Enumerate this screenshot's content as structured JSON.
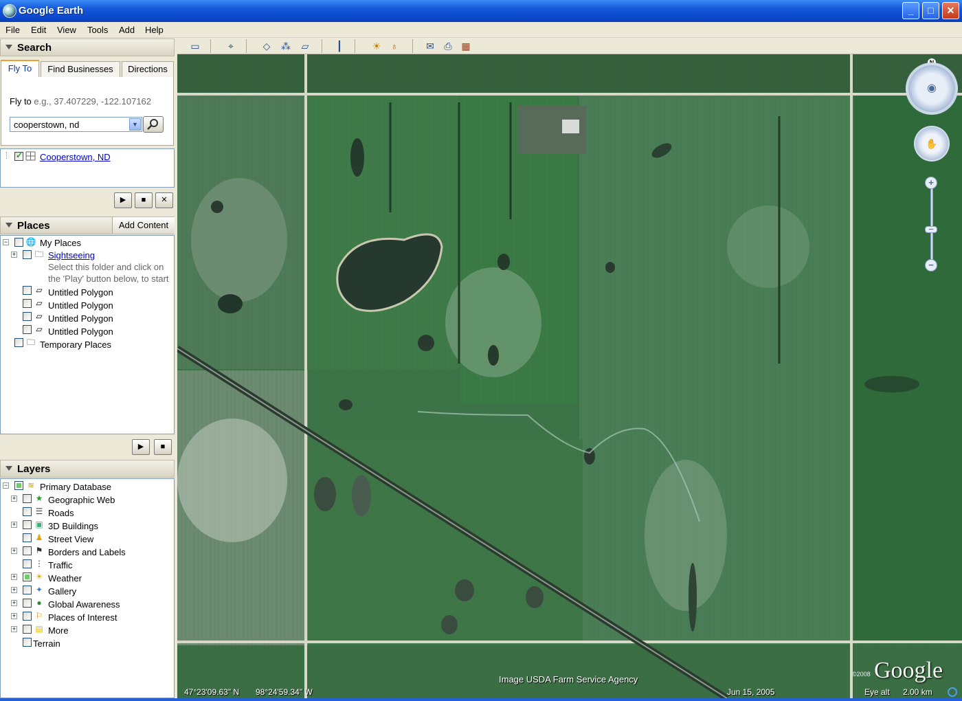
{
  "window": {
    "title": "Google Earth",
    "minimize": "_",
    "maximize": "□",
    "close": "✕"
  },
  "menu": [
    "File",
    "Edit",
    "View",
    "Tools",
    "Add",
    "Help"
  ],
  "search": {
    "header": "Search",
    "tabs": [
      "Fly To",
      "Find Businesses",
      "Directions"
    ],
    "fly_to_label": "Fly to",
    "fly_to_hint": "e.g., 37.407229, -122.107162",
    "input_value": "cooperstown, nd",
    "result": "Cooperstown, ND"
  },
  "places": {
    "header": "Places",
    "add_content": "Add Content",
    "my_places": "My Places",
    "sightseeing": "Sightseeing",
    "sightseeing_desc_1": "Select this folder and click on",
    "sightseeing_desc_2": "the 'Play' button below, to start",
    "polygons": [
      "Untitled Polygon",
      "Untitled Polygon",
      "Untitled Polygon",
      "Untitled Polygon"
    ],
    "temporary": "Temporary Places"
  },
  "layers": {
    "header": "Layers",
    "primary": "Primary Database",
    "items": [
      "Geographic Web",
      "Roads",
      "3D Buildings",
      "Street View",
      "Borders and Labels",
      "Traffic",
      "Weather",
      "Gallery",
      "Global Awareness",
      "Places of Interest",
      "More"
    ],
    "terrain": "Terrain"
  },
  "map": {
    "credit": "Image USDA Farm Service Agency",
    "lat": "47°23'09.63\" N",
    "lon": "98°24'59.34\" W",
    "date": "Jun 15, 2005",
    "eye_alt_label": "Eye alt",
    "eye_alt_value": "2.00 km",
    "logo": "Google",
    "copyright": "©2008",
    "north": "N"
  },
  "icons": {
    "search": "magnifier-icon",
    "play": "▶",
    "stop": "■",
    "close": "✕"
  }
}
